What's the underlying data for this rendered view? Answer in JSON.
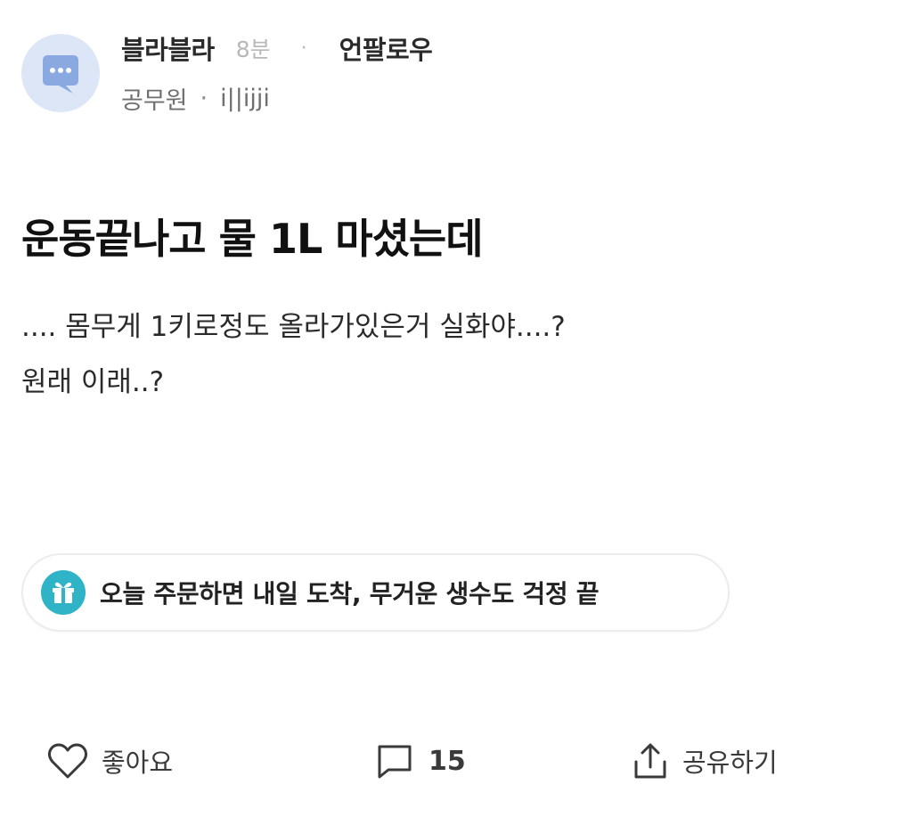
{
  "author": {
    "name": "블라블라",
    "time": "8분",
    "separator": "·",
    "follow_action": "언팔로우",
    "job": "공무원",
    "meta_separator": "·",
    "handle": "i||ijji",
    "avatar_icon": "chat-bubble-icon"
  },
  "post": {
    "title": "운동끝나고 물 1L 마셨는데",
    "body_lines": [
      ".... 몸무게 1키로정도 올라가있은거 실화야....?",
      "원래 이래..?"
    ]
  },
  "promo": {
    "icon": "gift-icon",
    "text": "오늘 주문하면 내일 도착, 무거운 생수도 걱정 끝"
  },
  "actions": {
    "like": {
      "icon": "heart-icon",
      "label": "좋아요"
    },
    "comment": {
      "icon": "comment-icon",
      "count": "15"
    },
    "share": {
      "icon": "share-icon",
      "label": "공유하기"
    }
  },
  "colors": {
    "avatar_bg": "#dde6f7",
    "avatar_bubble": "#8aa9e0",
    "promo_icon_bg": "#2fb3c7",
    "muted_text": "#b8b8b8"
  }
}
